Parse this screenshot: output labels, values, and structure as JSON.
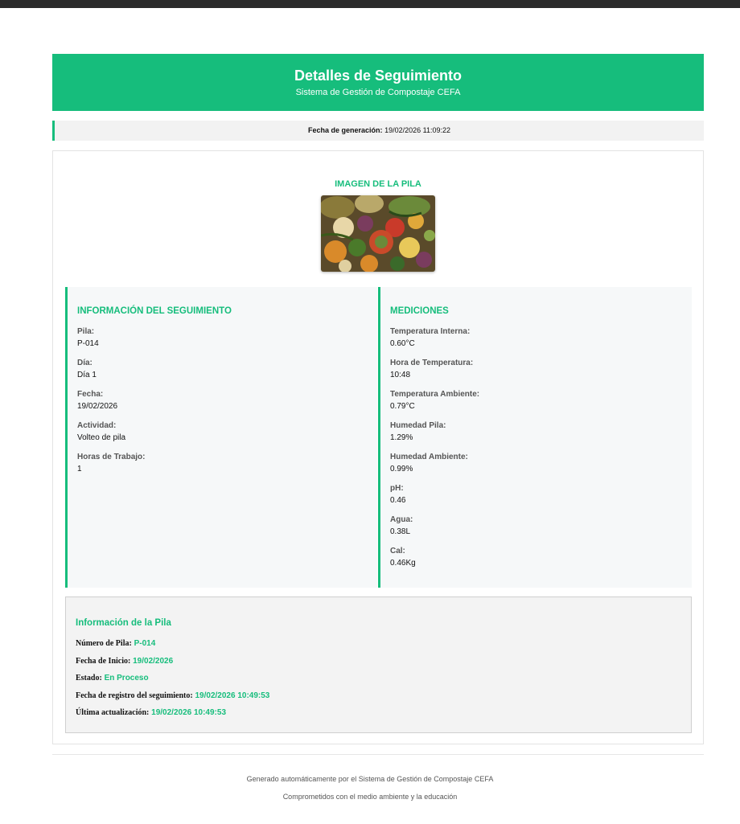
{
  "header": {
    "title": "Detalles de Seguimiento",
    "subtitle": "Sistema de Gestión de Compostaje CEFA"
  },
  "generation": {
    "label": "Fecha de generación:",
    "value": "19/02/2026 11:09:22"
  },
  "image_section": {
    "title": "IMAGEN DE LA PILA"
  },
  "seguimiento": {
    "title": "INFORMACIÓN DEL SEGUIMIENTO",
    "fields": [
      {
        "label": "Pila:",
        "value": "P-014"
      },
      {
        "label": "Día:",
        "value": "Día 1"
      },
      {
        "label": "Fecha:",
        "value": "19/02/2026"
      },
      {
        "label": "Actividad:",
        "value": "Volteo de pila"
      },
      {
        "label": "Horas de Trabajo:",
        "value": "1"
      }
    ]
  },
  "mediciones": {
    "title": "MEDICIONES",
    "fields": [
      {
        "label": "Temperatura Interna:",
        "value": "0.60°C"
      },
      {
        "label": "Hora de Temperatura:",
        "value": "10:48"
      },
      {
        "label": "Temperatura Ambiente:",
        "value": "0.79°C"
      },
      {
        "label": "Humedad Pila:",
        "value": "1.29%"
      },
      {
        "label": "Humedad Ambiente:",
        "value": "0.99%"
      },
      {
        "label": "pH:",
        "value": "0.46"
      },
      {
        "label": "Agua:",
        "value": "0.38L"
      },
      {
        "label": "Cal:",
        "value": "0.46Kg"
      }
    ]
  },
  "pila_info": {
    "title": "Información de la Pila",
    "rows": [
      {
        "label": "Número de Pila:",
        "value": "P-014"
      },
      {
        "label": "Fecha de Inicio:",
        "value": "19/02/2026"
      },
      {
        "label": "Estado:",
        "value": "En Proceso"
      },
      {
        "label": "Fecha de registro del seguimiento:",
        "value": "19/02/2026 10:49:53"
      },
      {
        "label": "Última actualización:",
        "value": "19/02/2026 10:49:53"
      }
    ]
  },
  "footer": {
    "line1": "Generado automáticamente por el Sistema de Gestión de Compostaje CEFA",
    "line2": "Comprometidos con el medio ambiente y la educación"
  },
  "colors": {
    "accent": "#16bd7c",
    "topbar": "#2b2b2b"
  }
}
